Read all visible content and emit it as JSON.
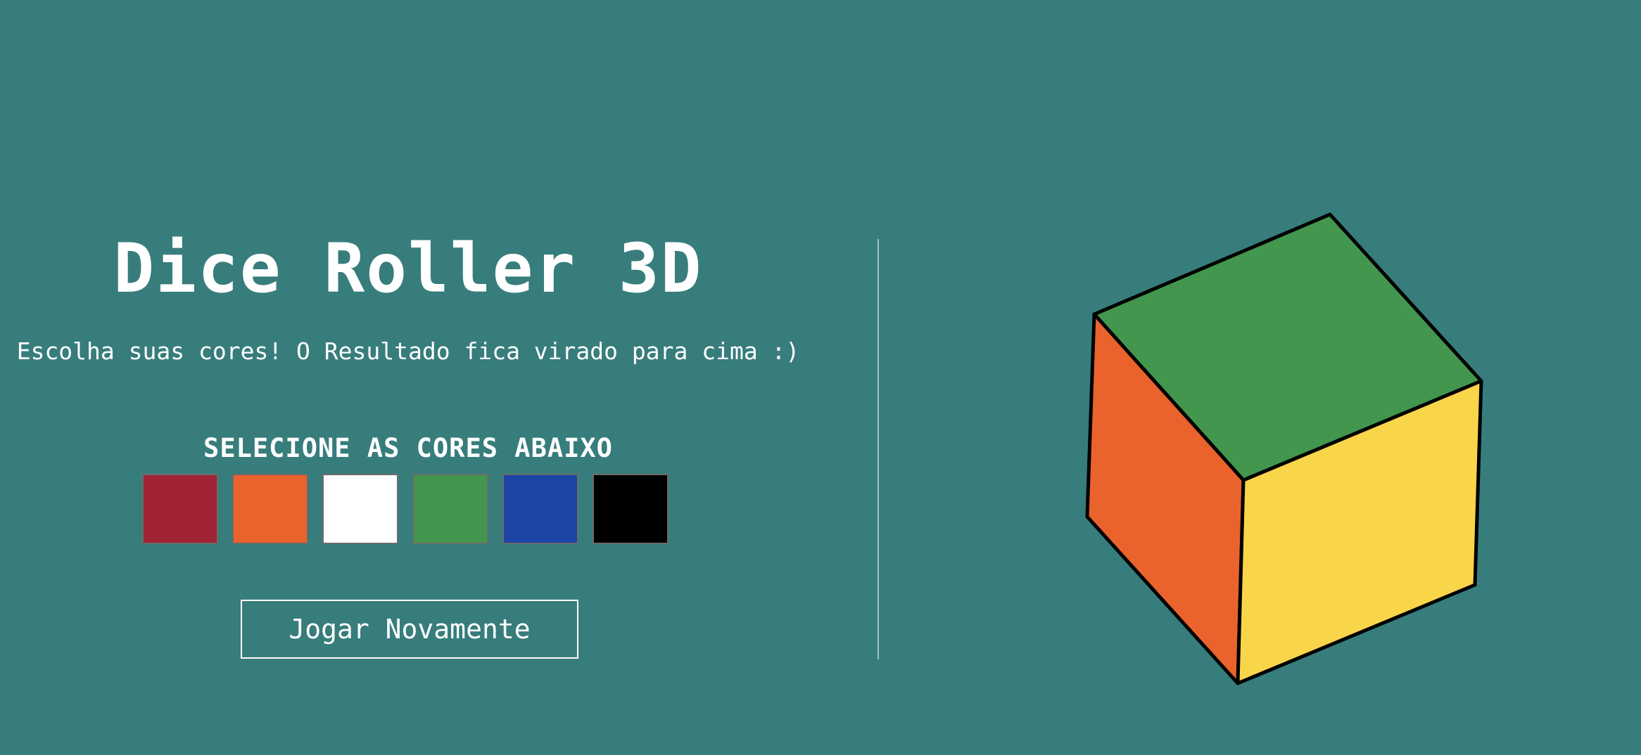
{
  "app": {
    "title": "Dice Roller 3D",
    "subtitle": "Escolha suas cores! O Resultado fica virado para cima :)",
    "select_heading": "SELECIONE AS CORES ABAIXO",
    "play_again_label": "Jogar Novamente"
  },
  "colors": {
    "background": "#377d7c",
    "swatch_options": [
      {
        "name": "red",
        "hex": "#a12336"
      },
      {
        "name": "orange",
        "hex": "#ea632c"
      },
      {
        "name": "white",
        "hex": "#ffffff"
      },
      {
        "name": "green",
        "hex": "#42964e"
      },
      {
        "name": "blue",
        "hex": "#1d45a6"
      },
      {
        "name": "black",
        "hex": "#000000"
      }
    ]
  },
  "dice": {
    "faces": {
      "top": "#42964e",
      "left": "#ea632c",
      "right": "#f9d549"
    }
  }
}
